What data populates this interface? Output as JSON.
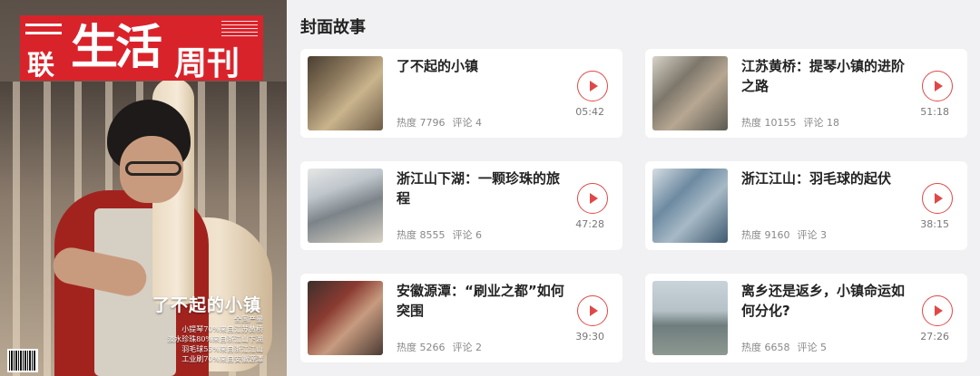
{
  "cover": {
    "mark_left": "联",
    "mark_main": "生活",
    "mark_right": "周刊",
    "headline": "了不起的小镇",
    "subs": [
      "全国产量",
      "小提琴70%来自江苏黄桥",
      "淡水珍珠80%来自浙江山下湖",
      "羽毛球55%来自浙江江山",
      "工业刷70%来自安徽源潭"
    ]
  },
  "section": {
    "title": "封面故事"
  },
  "cards": [
    {
      "title": "了不起的小镇",
      "heat_label": "热度 7796",
      "comment_label": "评论 4",
      "duration": "05:42",
      "thumb": "workshop-violins"
    },
    {
      "title": "江苏黄桥：提琴小镇的进阶之路",
      "heat_label": "热度 10155",
      "comment_label": "评论 18",
      "duration": "51:18",
      "thumb": "craftsman-at-desk"
    },
    {
      "title": "浙江山下湖：一颗珍珠的旅程",
      "heat_label": "热度 8555",
      "comment_label": "评论 6",
      "duration": "47:28",
      "thumb": "pearl-market"
    },
    {
      "title": "浙江江山：羽毛球的起伏",
      "heat_label": "热度 9160",
      "comment_label": "评论 3",
      "duration": "38:15",
      "thumb": "badminton-factory"
    },
    {
      "title": "安徽源潭：“刷业之都”如何突围",
      "heat_label": "热度 5266",
      "comment_label": "评论 2",
      "duration": "39:30",
      "thumb": "brush-workshop"
    },
    {
      "title": "离乡还是返乡，小镇命运如何分化?",
      "heat_label": "热度 6658",
      "comment_label": "评论 5",
      "duration": "27:26",
      "thumb": "town-aerial"
    }
  ],
  "colors": {
    "accent": "#e04848",
    "masthead": "#d9232b",
    "background": "#f1f1f3"
  },
  "icons": {
    "play": "play-circle-icon"
  }
}
